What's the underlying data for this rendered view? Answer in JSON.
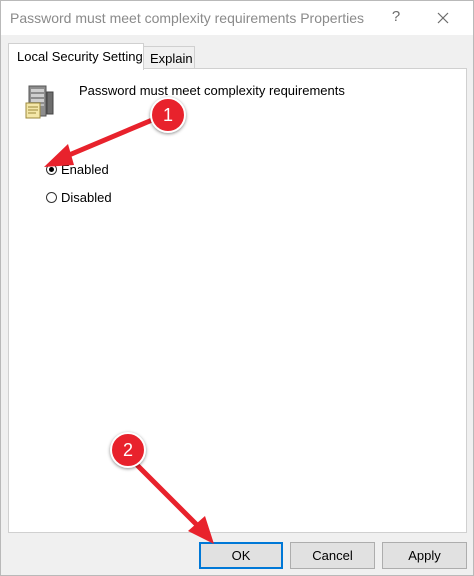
{
  "window": {
    "title": "Password must meet complexity requirements Properties",
    "help_glyph": "?"
  },
  "tabs": [
    {
      "label": "Local Security Setting",
      "active": true
    },
    {
      "label": "Explain",
      "active": false
    }
  ],
  "policy": {
    "title": "Password must meet complexity requirements",
    "icon": "policy-server-icon"
  },
  "options": [
    {
      "label": "Enabled",
      "selected": true
    },
    {
      "label": "Disabled",
      "selected": false
    }
  ],
  "buttons": {
    "ok": "OK",
    "cancel": "Cancel",
    "apply": "Apply"
  },
  "annotations": [
    {
      "number": "1",
      "points_to": "Enabled"
    },
    {
      "number": "2",
      "points_to": "OK"
    }
  ],
  "colors": {
    "annotation_red": "#e8222c",
    "ok_focus_border": "#0078d7",
    "window_bg": "#f0f0f0"
  }
}
